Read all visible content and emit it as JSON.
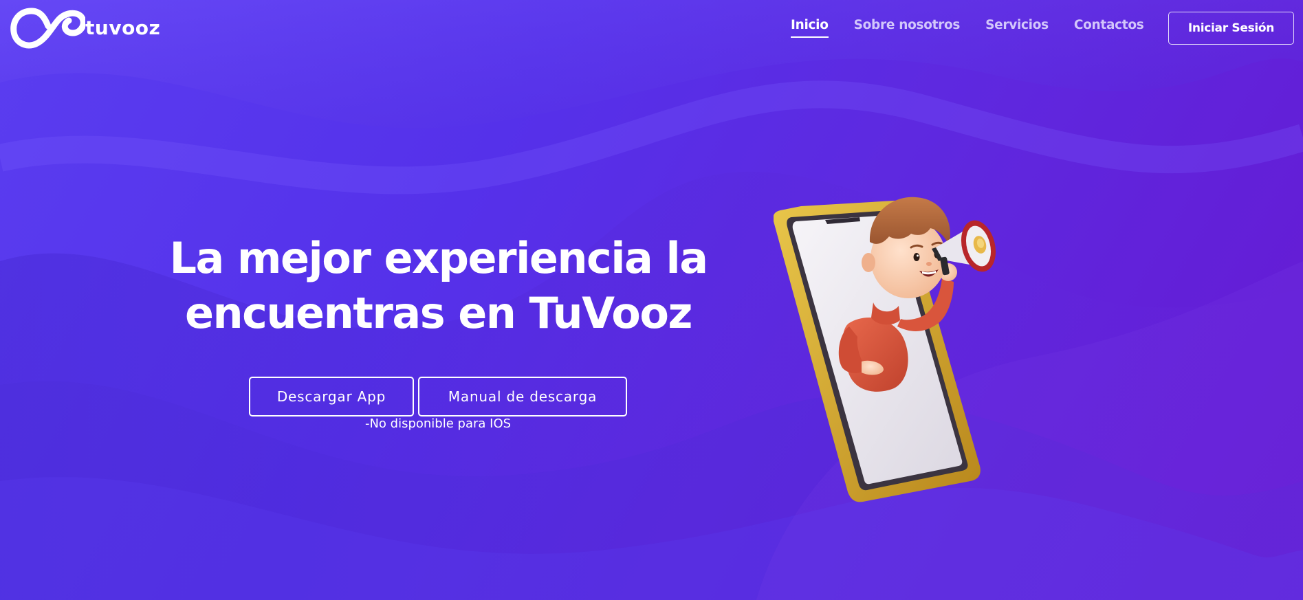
{
  "brand": {
    "name": "tuvooz"
  },
  "nav": {
    "items": [
      {
        "label": "Inicio",
        "active": true
      },
      {
        "label": "Sobre nosotros",
        "active": false
      },
      {
        "label": "Servicios",
        "active": false
      },
      {
        "label": "Contactos",
        "active": false
      }
    ],
    "login_label": "Iniciar Sesión"
  },
  "hero": {
    "headline_line1": "La mejor experiencia la",
    "headline_line2": "encuentras en TuVooz",
    "download_label": "Descargar App",
    "manual_label": "Manual de descarga",
    "note": "-No disponible para IOS"
  },
  "illustration": {
    "icon": "boy-with-megaphone-in-phone-illustration"
  },
  "colors": {
    "background": "#5a34ea",
    "background_end": "#6619d2",
    "text": "#ffffff",
    "phone_frame": "#d9a92c",
    "shirt": "#d9553c",
    "hair": "#b5673a",
    "megaphone_red": "#b8262a"
  }
}
